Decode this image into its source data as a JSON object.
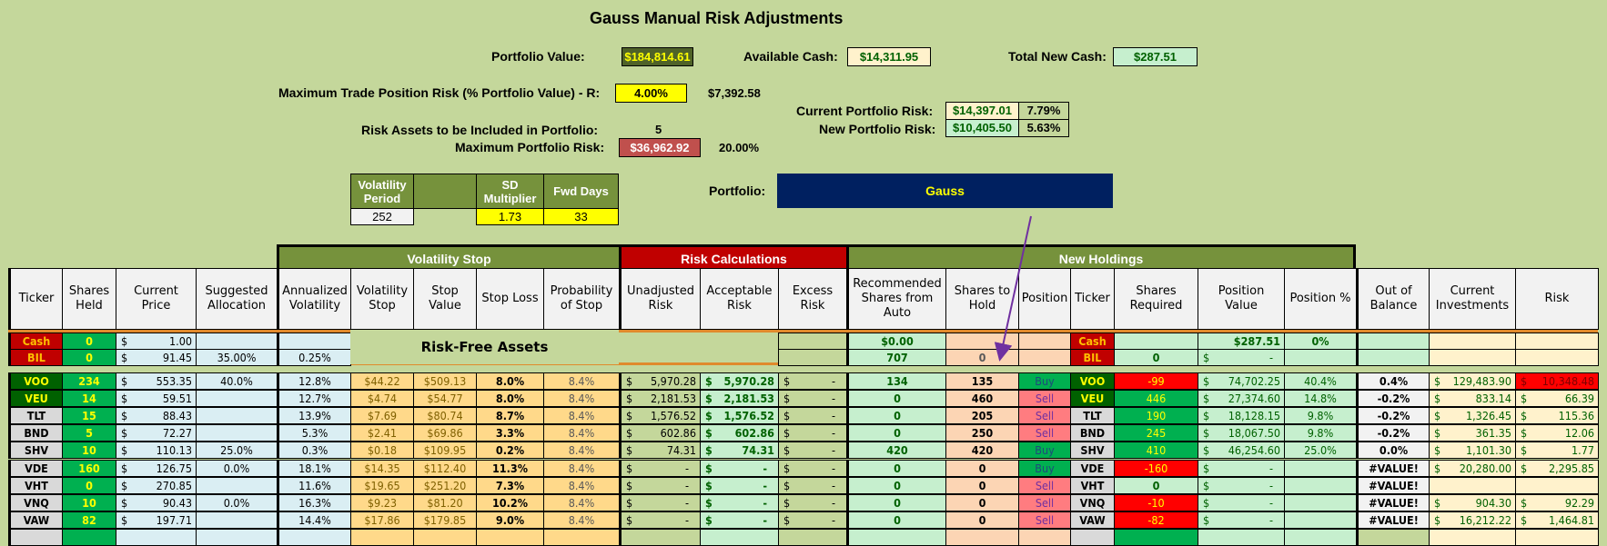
{
  "title": "Gauss Manual Risk Adjustments",
  "summary": {
    "portfolio_value_label": "Portfolio Value:",
    "portfolio_value": "$184,814.61",
    "available_cash_label": "Available Cash:",
    "available_cash": "$14,311.95",
    "total_new_cash_label": "Total New Cash:",
    "total_new_cash": "$287.51",
    "max_trade_risk_label": "Maximum Trade Position Risk (% Portfolio Value) - R:",
    "max_trade_risk_pct": "4.00%",
    "max_trade_risk_value": "$7,392.58",
    "current_risk_label": "Current Portfolio Risk:",
    "current_risk_value": "$14,397.01",
    "current_risk_pct": "7.79%",
    "new_risk_label": "New Portfolio Risk:",
    "new_risk_value": "$10,405.50",
    "new_risk_pct": "5.63%",
    "risk_assets_label": "Risk Assets to be Included in Portfolio:",
    "risk_assets_value": "5",
    "max_portfolio_risk_label": "Maximum Portfolio Risk:",
    "max_portfolio_risk_value": "$36,962.92",
    "max_portfolio_risk_pct": "20.00%"
  },
  "params": {
    "headers": [
      "Volatility Period",
      "",
      "SD Multiplier",
      "Fwd Days"
    ],
    "values": [
      "252",
      "",
      "1.73",
      "33"
    ]
  },
  "portfolio": {
    "label": "Portfolio:",
    "name": "Gauss"
  },
  "groups": {
    "volatility_stop": "Volatility Stop",
    "risk_calculations": "Risk Calculations",
    "new_holdings": "New Holdings"
  },
  "columns": [
    "Ticker",
    "Shares Held",
    "Current Price",
    "Suggested Allocation",
    "Annualized Volatility",
    "Volatility Stop",
    "Stop Value",
    "Stop Loss",
    "Probability of Stop",
    "Unadjusted Risk",
    "Acceptable Risk",
    "Excess Risk",
    "Recommended Shares from Auto",
    "Shares to Hold",
    "Position",
    "Ticker",
    "Shares Required",
    "Position Value",
    "Position %",
    "Out of Balance",
    "Current Investments",
    "Risk"
  ],
  "risk_free_label": "Risk-Free Assets",
  "risk_free_rows": [
    {
      "ticker": "Cash",
      "shares": "0",
      "price": "1.00",
      "alloc": "",
      "vol": "",
      "rec": "$0.00",
      "hold": "",
      "pos": "",
      "ticker2": "Cash",
      "req": "",
      "value": "$287.51",
      "pct": "0%"
    },
    {
      "ticker": "BIL",
      "shares": "0",
      "price": "91.45",
      "alloc": "35.00%",
      "vol": "0.25%",
      "rec": "707",
      "hold": "0",
      "pos": "",
      "ticker2": "BIL",
      "req": "0",
      "value": "-",
      "pct": ""
    }
  ],
  "rows": [
    {
      "ticker": "VOO",
      "held_flag": true,
      "shares": "234",
      "price": "553.35",
      "alloc": "40.0%",
      "vol": "12.8%",
      "vstop": "$44.22",
      "sval": "$509.13",
      "sloss": "8.0%",
      "prob": "8.4%",
      "unadj": "5,970.28",
      "accept": "5,970.28",
      "excess": "-",
      "rec": "134",
      "hold": "135",
      "pos": "Buy",
      "req": "-99",
      "value": "74,702.25",
      "pct": "40.4%",
      "oob": "0.4%",
      "inv": "129,483.90",
      "risk": "10,348.48",
      "risk_flag": true
    },
    {
      "ticker": "VEU",
      "held_flag": true,
      "shares": "14",
      "price": "59.51",
      "alloc": "",
      "vol": "12.7%",
      "vstop": "$4.74",
      "sval": "$54.77",
      "sloss": "8.0%",
      "prob": "8.4%",
      "unadj": "2,181.53",
      "accept": "2,181.53",
      "excess": "-",
      "rec": "0",
      "hold": "460",
      "pos": "Sell",
      "req": "446",
      "value": "27,374.60",
      "pct": "14.8%",
      "oob": "-0.2%",
      "inv": "833.14",
      "risk": "66.39"
    },
    {
      "ticker": "TLT",
      "shares": "15",
      "price": "88.43",
      "alloc": "",
      "vol": "13.9%",
      "vstop": "$7.69",
      "sval": "$80.74",
      "sloss": "8.7%",
      "prob": "8.4%",
      "unadj": "1,576.52",
      "accept": "1,576.52",
      "excess": "-",
      "rec": "0",
      "hold": "205",
      "pos": "Sell",
      "req": "190",
      "value": "18,128.15",
      "pct": "9.8%",
      "oob": "-0.2%",
      "inv": "1,326.45",
      "risk": "115.36"
    },
    {
      "ticker": "BND",
      "shares": "5",
      "price": "72.27",
      "alloc": "",
      "vol": "5.3%",
      "vstop": "$2.41",
      "sval": "$69.86",
      "sloss": "3.3%",
      "prob": "8.4%",
      "unadj": "602.86",
      "accept": "602.86",
      "excess": "-",
      "rec": "0",
      "hold": "250",
      "pos": "Sell",
      "req": "245",
      "value": "18,067.50",
      "pct": "9.8%",
      "oob": "-0.2%",
      "inv": "361.35",
      "risk": "12.06"
    },
    {
      "ticker": "SHV",
      "shares": "10",
      "price": "110.13",
      "alloc": "25.0%",
      "vol": "0.3%",
      "vstop": "$0.18",
      "sval": "$109.95",
      "sloss": "0.2%",
      "prob": "8.4%",
      "unadj": "74.31",
      "accept": "74.31",
      "excess": "-",
      "rec": "420",
      "hold": "420",
      "pos": "Buy",
      "req": "410",
      "value": "46,254.60",
      "pct": "25.0%",
      "oob": "0.0%",
      "inv": "1,101.30",
      "risk": "1.77"
    },
    {
      "ticker": "VDE",
      "shares": "160",
      "price": "126.75",
      "alloc": "0.0%",
      "vol": "18.1%",
      "vstop": "$14.35",
      "sval": "$112.40",
      "sloss": "11.3%",
      "prob": "8.4%",
      "unadj": "-",
      "accept": "-",
      "excess": "-",
      "rec": "0",
      "hold": "0",
      "pos": "Buy",
      "req": "-160",
      "value": "-",
      "pct": "",
      "oob": "#VALUE!",
      "inv": "20,280.00",
      "risk": "2,295.85"
    },
    {
      "ticker": "VHT",
      "shares": "0",
      "price": "270.85",
      "alloc": "",
      "vol": "11.6%",
      "vstop": "$19.65",
      "sval": "$251.20",
      "sloss": "7.3%",
      "prob": "8.4%",
      "unadj": "-",
      "accept": "-",
      "excess": "-",
      "rec": "0",
      "hold": "0",
      "pos": "Sell",
      "req": "0",
      "value": "-",
      "pct": "",
      "oob": "#VALUE!",
      "inv": "",
      "risk": ""
    },
    {
      "ticker": "VNQ",
      "shares": "10",
      "price": "90.43",
      "alloc": "0.0%",
      "vol": "16.3%",
      "vstop": "$9.23",
      "sval": "$81.20",
      "sloss": "10.2%",
      "prob": "8.4%",
      "unadj": "-",
      "accept": "-",
      "excess": "-",
      "rec": "0",
      "hold": "0",
      "pos": "Sell",
      "req": "-10",
      "value": "-",
      "pct": "",
      "oob": "#VALUE!",
      "inv": "904.30",
      "risk": "92.29"
    },
    {
      "ticker": "VAW",
      "shares": "82",
      "price": "197.71",
      "alloc": "",
      "vol": "14.4%",
      "vstop": "$17.86",
      "sval": "$179.85",
      "sloss": "9.0%",
      "prob": "8.4%",
      "unadj": "-",
      "accept": "-",
      "excess": "-",
      "rec": "0",
      "hold": "0",
      "pos": "Sell",
      "req": "-82",
      "value": "-",
      "pct": "",
      "oob": "#VALUE!",
      "inv": "16,212.22",
      "risk": "1,464.81"
    }
  ],
  "colors": {
    "background": "#c4d79b",
    "group_green": "#76923c",
    "group_red": "#c00000",
    "ticker_red": "#c00000",
    "ticker_dark_green": "#006100",
    "shares_green": "#00b050",
    "light_blue": "#daeef3",
    "tan": "#ffd98a",
    "olive": "#c4d79b",
    "mint": "#c6efce",
    "peach": "#fcd5b4",
    "buy": "#00b050",
    "sell": "#ff7c80",
    "neg_red": "#ff0000",
    "navy": "#002060",
    "yellow": "#ffff00"
  }
}
